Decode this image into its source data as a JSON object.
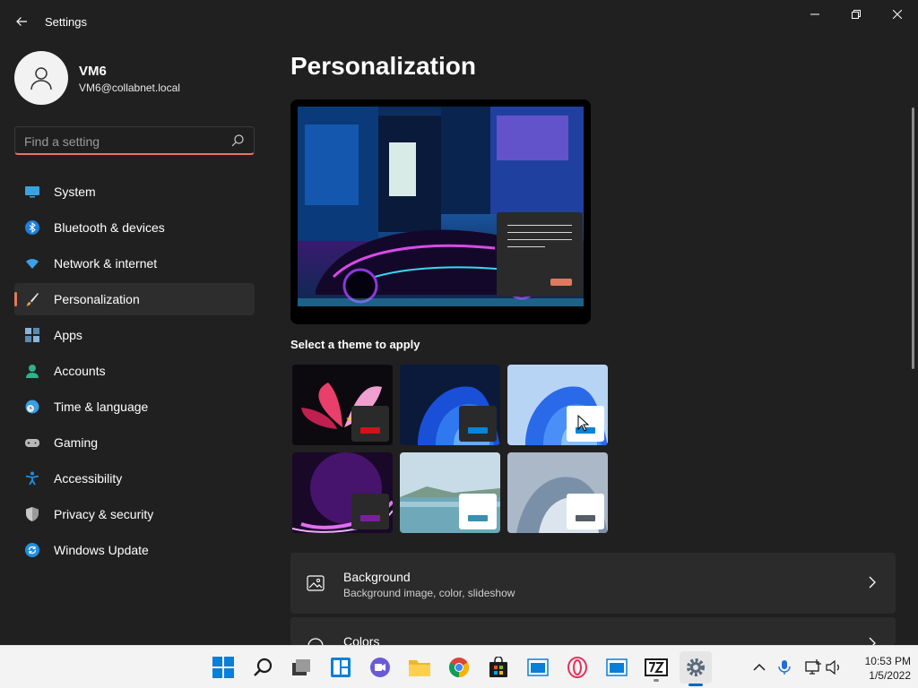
{
  "window": {
    "title": "Settings"
  },
  "profile": {
    "name": "VM6",
    "email": "VM6@collabnet.local"
  },
  "search": {
    "placeholder": "Find a setting"
  },
  "nav": {
    "items": [
      {
        "label": "System",
        "icon": "monitor-icon"
      },
      {
        "label": "Bluetooth & devices",
        "icon": "bluetooth-icon"
      },
      {
        "label": "Network & internet",
        "icon": "wifi-icon"
      },
      {
        "label": "Personalization",
        "icon": "brush-icon",
        "active": true
      },
      {
        "label": "Apps",
        "icon": "apps-icon"
      },
      {
        "label": "Accounts",
        "icon": "person-icon"
      },
      {
        "label": "Time & language",
        "icon": "clock-globe-icon"
      },
      {
        "label": "Gaming",
        "icon": "gamepad-icon"
      },
      {
        "label": "Accessibility",
        "icon": "accessibility-icon"
      },
      {
        "label": "Privacy & security",
        "icon": "shield-icon"
      },
      {
        "label": "Windows Update",
        "icon": "update-icon"
      }
    ]
  },
  "main": {
    "title": "Personalization",
    "themes_label": "Select a theme to apply",
    "themes": [
      {
        "name": "flower-dark",
        "accent": "#d0121a"
      },
      {
        "name": "bloom-dark",
        "accent": "#0a84d6"
      },
      {
        "name": "bloom-light",
        "accent": "#0a84d6",
        "selected": true
      },
      {
        "name": "glow",
        "accent": "#7a1fa2"
      },
      {
        "name": "captured-motion",
        "accent": "#3a8fb0"
      },
      {
        "name": "flow",
        "accent": "#555d66"
      }
    ],
    "cards": [
      {
        "title": "Background",
        "subtitle": "Background image, color, slideshow"
      },
      {
        "title": "Colors",
        "subtitle": ""
      }
    ]
  },
  "taskbar": {
    "apps": [
      "start-icon",
      "search-icon",
      "task-view-icon",
      "widgets-icon",
      "teams-chat-icon",
      "file-explorer-icon",
      "chrome-icon",
      "store-icon",
      "app-window-icon",
      "opera-icon",
      "app-window-icon",
      "7zip-icon",
      "settings-icon"
    ],
    "clock": {
      "time": "10:53 PM",
      "date": "1/5/2022"
    }
  },
  "colors": {
    "accent": "#e07a5f",
    "background": "#202020",
    "card": "#2b2b2b"
  }
}
